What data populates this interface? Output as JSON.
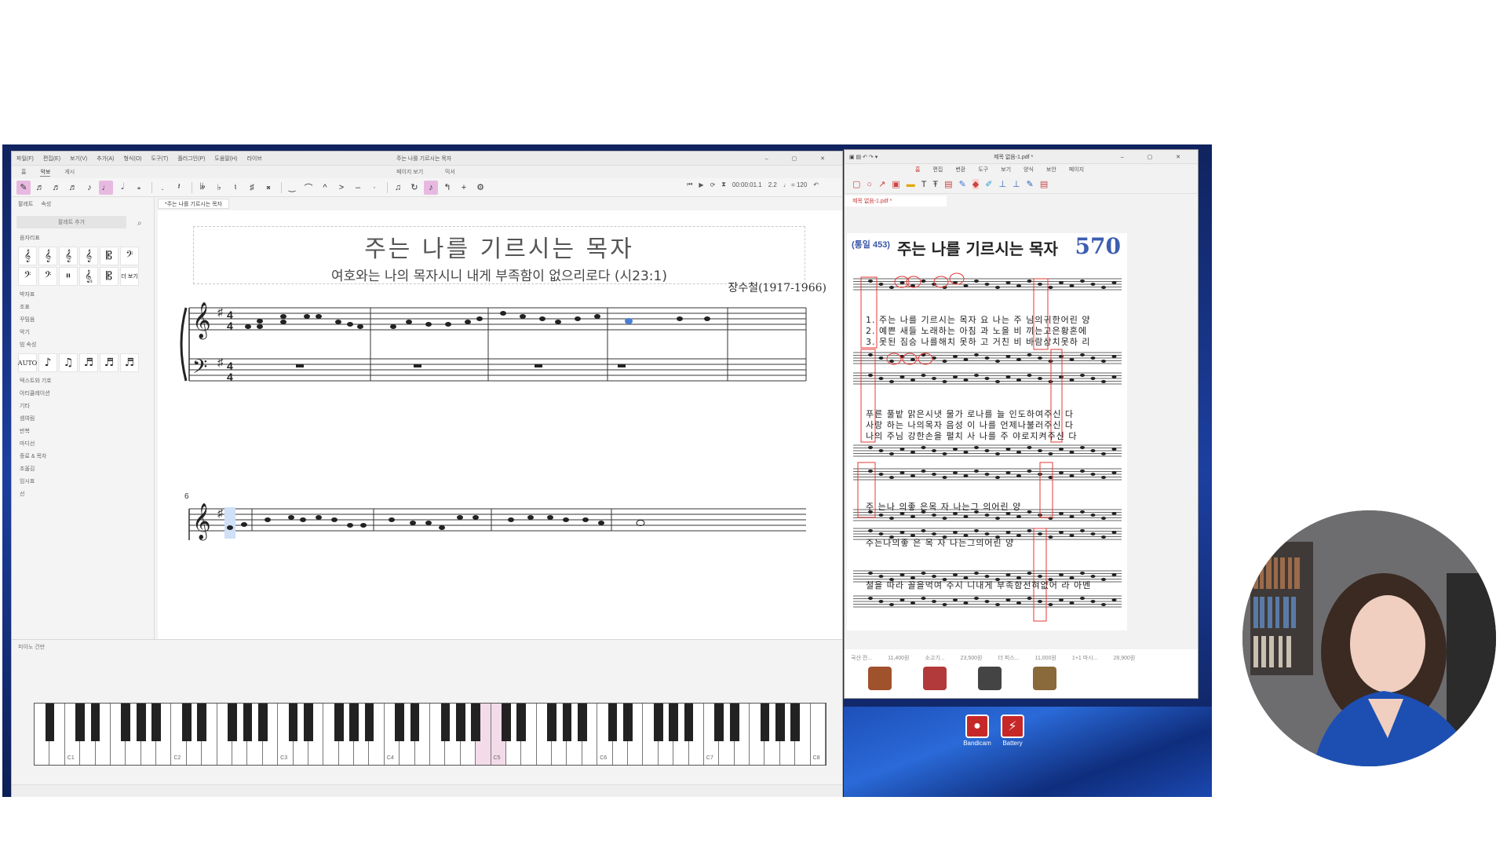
{
  "musescore": {
    "menu": [
      "파일(F)",
      "편집(E)",
      "보기(V)",
      "추가(A)",
      "형식(O)",
      "도구(T)",
      "플러그인(P)",
      "도움말(H)",
      "라이브"
    ],
    "window_title": "주는 나를 기르시는 목자",
    "tabs": [
      "홈",
      "악보",
      "게시"
    ],
    "view_mode": "페이지 보기",
    "mixer_label": "믹서",
    "time_display": "00:00:01.1",
    "measure_beat": "2.2",
    "tempo": "♩ = 120",
    "palette_tabs": [
      "팔레트",
      "속성"
    ],
    "palette_add": "팔레트 추가",
    "palette_sections": [
      "음자리표",
      "박자표",
      "조표",
      "꾸밈음",
      "악기",
      "빔 속성"
    ],
    "palette_more": "더 보기",
    "palette_lower_sections": [
      "텍스트와 기호",
      "아티큘레이션",
      "기타",
      "셈여림",
      "반복",
      "마디선",
      "종료 & 목자",
      "조옮김",
      "임시표",
      "선"
    ],
    "doc_tab": "*주는 나를 기르시는 목자",
    "score_title": "주는 나를 기르시는 목자",
    "score_subtitle": "여호와는 나의 목자시니 내게 부족함이 없으리로다 (시23:1)",
    "score_composer": "장수철(1917-1966)",
    "measure_number_second_system": "6",
    "piano_panel_label": "피아노 건반",
    "octave_labels": [
      "C1",
      "C2",
      "C3",
      "C4",
      "C5",
      "C6",
      "C7",
      "C8"
    ]
  },
  "pdf_viewer": {
    "window_title": "제목 없음-1.pdf *",
    "menu": [
      "홈",
      "편집",
      "변환",
      "도구",
      "보기",
      "양식",
      "보안",
      "페이지"
    ],
    "active_menu": "홈",
    "tab_label": "제목 없음-1.pdf *",
    "hymn_old_number": "(통일 453)",
    "hymn_title": "주는 나를 기르시는 목자",
    "hymn_number": "570",
    "lyrics_system1": [
      "1. 주는 나를 기르시는 목자 요 나는 주 님의귀한어린 양",
      "2. 예쁜 새들 노래하는 아침 과 노을 비 끼는고은황혼에",
      "3. 못된 짐승 나를해치 못하 고 거친 비 바람상치못하 리"
    ],
    "lyrics_system2": [
      "푸른 풀밭 맑은시냇 물가 로나를 늘 인도하여주신 다",
      "사랑 하는 나의목자 음성 이 나를 언제나불러주신 다",
      "나의 주님 강한손을 펼치 사 나를 주 야로지켜주신 다"
    ],
    "lyrics_system3a": "주 는나     의좋 은목     자 나는그     의어린 양",
    "lyrics_system3b": "주는나의좋 은 목     자     나는그의어린 양",
    "lyrics_system4": "철을 따라 꼴을먹여 주시 니내게 부족함전혀없어 라 아멘",
    "ad_labels": [
      "국산 전...",
      "11,400원",
      "소고기...",
      "23,500원",
      "더 피스...",
      "11,000원",
      "1+1 마시...",
      "28,900원"
    ],
    "desktop_icons": [
      "Bandicam",
      "Battery"
    ]
  },
  "colors": {
    "score_accent": "#e8b9e0",
    "pdf_accent": "#c62828",
    "hymn_number_color": "#3b5eb0",
    "annotation_red": "#e53935"
  }
}
